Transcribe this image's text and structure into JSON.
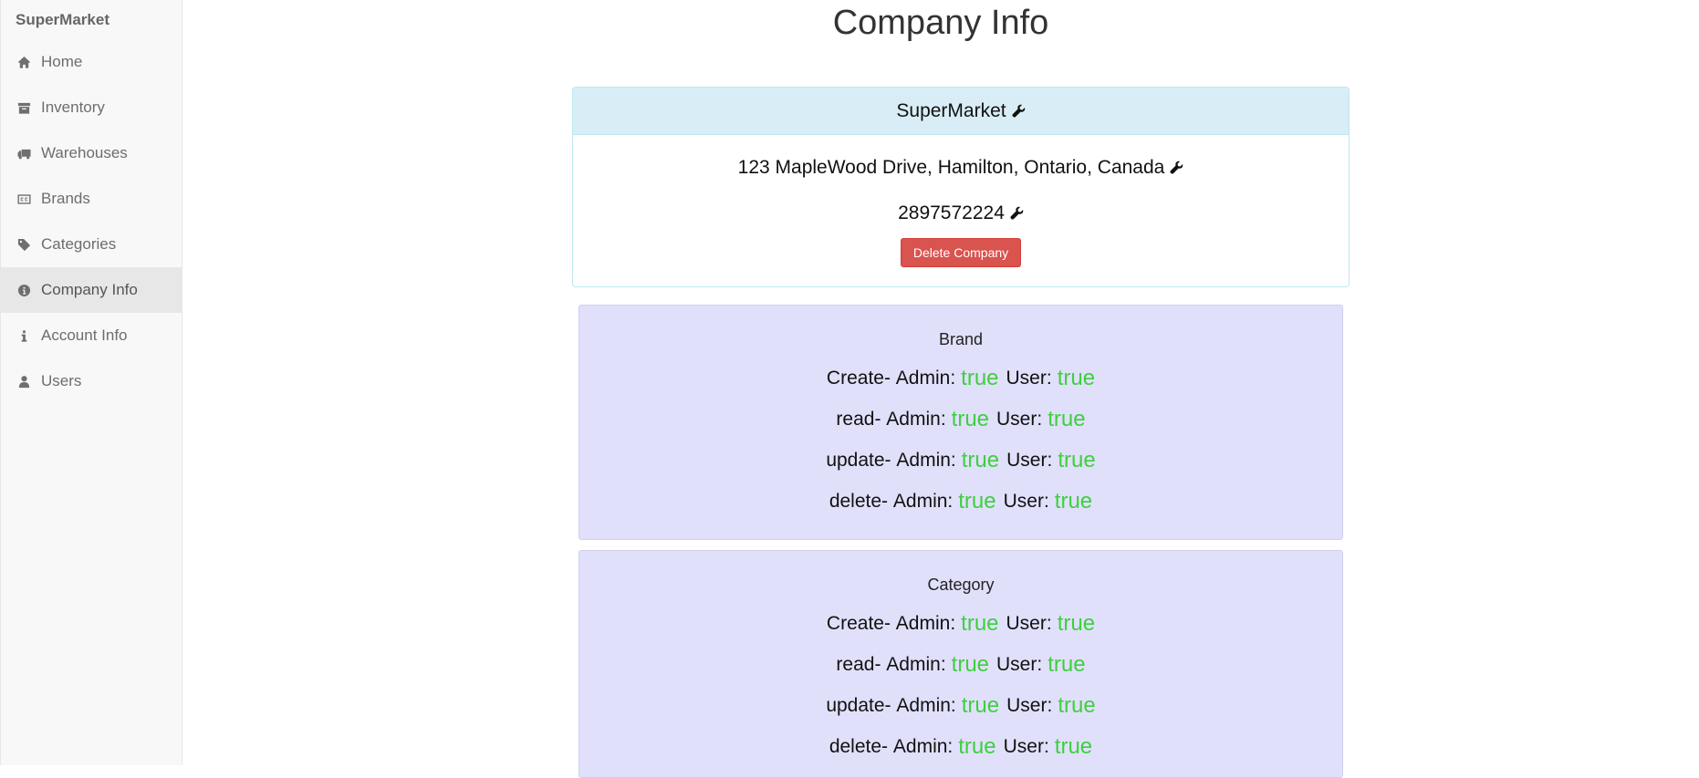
{
  "sidebar": {
    "brand": "SuperMarket",
    "items": [
      {
        "label": "Home",
        "icon": "home-icon"
      },
      {
        "label": "Inventory",
        "icon": "archive-icon"
      },
      {
        "label": "Warehouses",
        "icon": "truck-icon"
      },
      {
        "label": "Brands",
        "icon": "cc-icon"
      },
      {
        "label": "Categories",
        "icon": "tag-icon"
      },
      {
        "label": "Company Info",
        "icon": "info-circle-icon",
        "active": true
      },
      {
        "label": "Account Info",
        "icon": "info-icon"
      },
      {
        "label": "Users",
        "icon": "user-icon"
      }
    ]
  },
  "main": {
    "title": "Company Info",
    "company": {
      "name": "SuperMarket",
      "address": "123 MapleWood Drive, Hamilton, Ontario, Canada",
      "phone": "2897572224",
      "delete_label": "Delete Company"
    },
    "permission_labels": {
      "admin": "Admin:",
      "user": "User:"
    },
    "permissions": [
      {
        "title": "Brand",
        "rows": [
          {
            "action": "Create-",
            "admin": "true",
            "user": "true"
          },
          {
            "action": "read-",
            "admin": "true",
            "user": "true"
          },
          {
            "action": "update-",
            "admin": "true",
            "user": "true"
          },
          {
            "action": "delete-",
            "admin": "true",
            "user": "true"
          }
        ]
      },
      {
        "title": "Category",
        "rows": [
          {
            "action": "Create-",
            "admin": "true",
            "user": "true"
          },
          {
            "action": "read-",
            "admin": "true",
            "user": "true"
          },
          {
            "action": "update-",
            "admin": "true",
            "user": "true"
          },
          {
            "action": "delete-",
            "admin": "true",
            "user": "true"
          }
        ]
      }
    ]
  },
  "colors": {
    "true_value": "#3fcf3f",
    "panel_header": "#d9edf7",
    "permission_card": "#e0e0fb",
    "danger_button": "#d9534f",
    "active_nav": "#e7e7e7"
  }
}
